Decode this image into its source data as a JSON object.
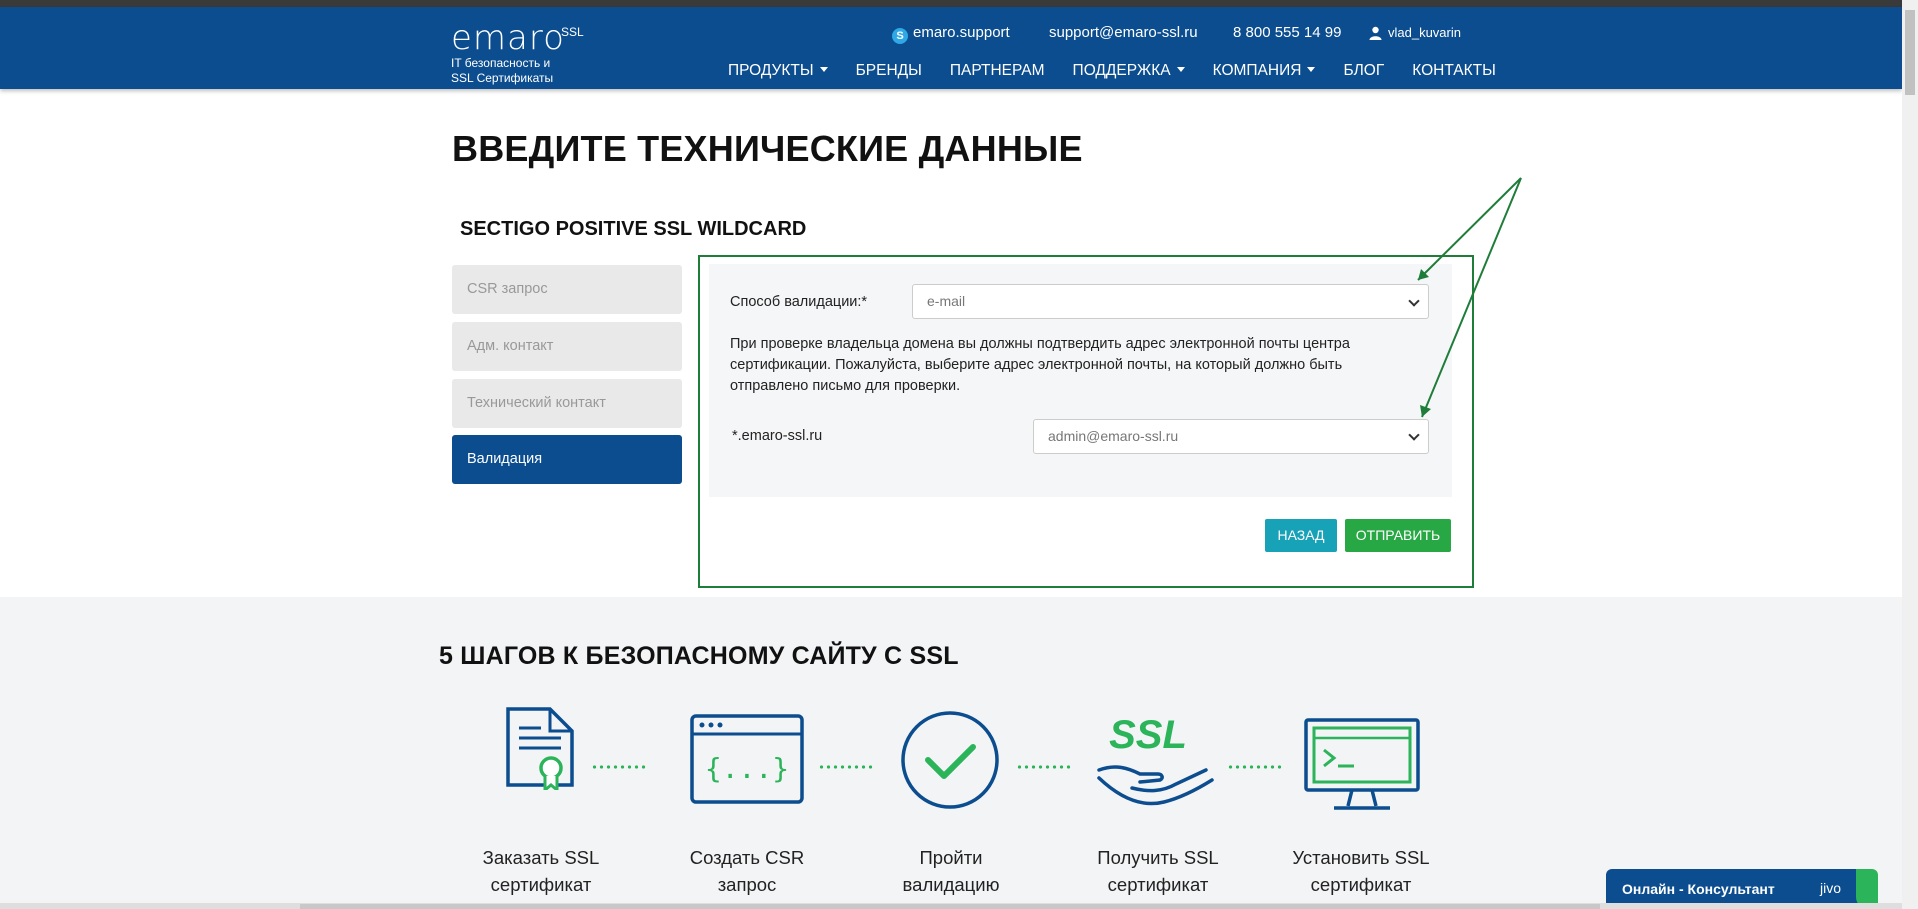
{
  "header": {
    "logo_word": "emaro",
    "logo_ssl": "SSL",
    "logo_tagline_1": "IT безопасность и",
    "logo_tagline_2": "SSL Сертификаты",
    "skype": "emaro.support",
    "email": "support@emaro-ssl.ru",
    "phone": "8 800 555 14 99",
    "user": "vlad_kuvarin"
  },
  "nav": {
    "items": [
      {
        "label": "ПРОДУКТЫ",
        "has_dropdown": true
      },
      {
        "label": "БРЕНДЫ",
        "has_dropdown": false
      },
      {
        "label": "ПАРТНЕРАМ",
        "has_dropdown": false
      },
      {
        "label": "ПОДДЕРЖКА",
        "has_dropdown": true
      },
      {
        "label": "КОМПАНИЯ",
        "has_dropdown": true
      },
      {
        "label": "БЛОГ",
        "has_dropdown": false
      },
      {
        "label": "КОНТАКТЫ",
        "has_dropdown": false
      }
    ]
  },
  "page": {
    "title": "ВВЕДИТЕ ТЕХНИЧЕСКИЕ ДАННЫЕ",
    "product": "SECTIGO POSITIVE SSL WILDCARD"
  },
  "sidebar": {
    "items": [
      {
        "label": "CSR запрос",
        "active": false
      },
      {
        "label": "Адм. контакт",
        "active": false
      },
      {
        "label": "Технический контакт",
        "active": false
      },
      {
        "label": "Валидация",
        "active": true
      }
    ]
  },
  "form": {
    "validation_label": "Способ валидации:*",
    "validation_value": "e-mail",
    "help_text": "При проверке владельца домена вы должны подтвердить адрес электронной почты центра сертификации. Пожалуйста, выберите адрес электронной почты, на который должно быть отправлено письмо для проверки.",
    "domain_label": "*.emaro-ssl.ru",
    "email_value": "admin@emaro-ssl.ru",
    "back_label": "НАЗАД",
    "send_label": "ОТПРАВИТЬ"
  },
  "steps": {
    "title": "5 ШАГОВ К БЕЗОПАСНОМУ САЙТУ С SSL",
    "items": [
      {
        "line1": "Заказать SSL",
        "line2": "сертификат",
        "icon": "certificate-icon"
      },
      {
        "line1": "Создать CSR",
        "line2": "запрос",
        "icon": "code-window-icon"
      },
      {
        "line1": "Пройти",
        "line2": "валидацию",
        "icon": "checkmark-circle-icon"
      },
      {
        "line1": "Получить SSL",
        "line2": "сертификат",
        "icon": "ssl-hand-icon"
      },
      {
        "line1": "Установить SSL",
        "line2": "сертификат",
        "icon": "monitor-terminal-icon"
      }
    ],
    "ssl_icon_text": "SSL",
    "code_icon_text": "{...}"
  },
  "chat": {
    "label": "Онлайн - Консультант",
    "brand": "jivo"
  },
  "colors": {
    "header_bg": "#0b4d8e",
    "accent_green": "#28a745",
    "accent_teal": "#17a2b8",
    "annotation_green": "#1f7d3a"
  }
}
